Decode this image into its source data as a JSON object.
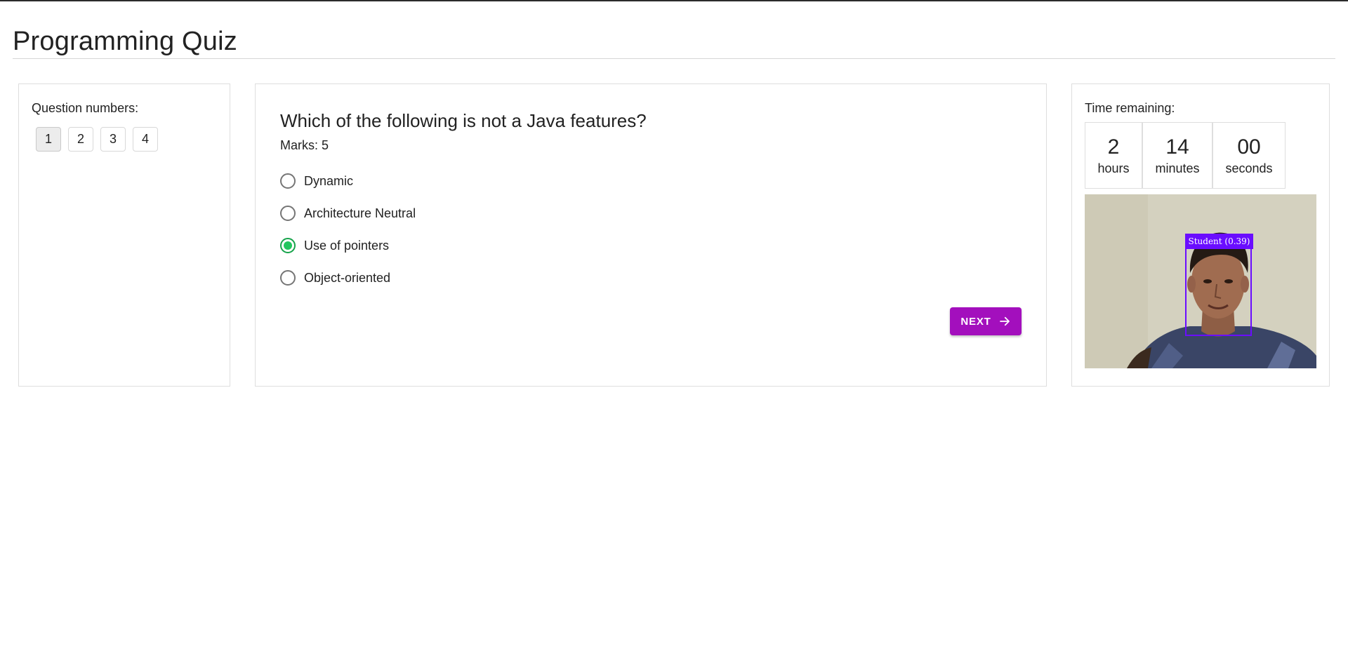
{
  "page": {
    "title": "Programming Quiz"
  },
  "question_nav": {
    "label": "Question numbers:",
    "numbers": [
      "1",
      "2",
      "3",
      "4"
    ],
    "active_index": 0
  },
  "question": {
    "text": "Which of the following is not a Java features?",
    "marks": "Marks: 5",
    "options": [
      {
        "label": "Dynamic",
        "selected": false
      },
      {
        "label": "Architecture Neutral",
        "selected": false
      },
      {
        "label": "Use of pointers",
        "selected": true
      },
      {
        "label": "Object-oriented",
        "selected": false
      }
    ],
    "next_label": "NEXT"
  },
  "timer": {
    "label": "Time remaining:",
    "hours": "2",
    "hours_unit": "hours",
    "minutes": "14",
    "minutes_unit": "minutes",
    "seconds": "00",
    "seconds_unit": "seconds"
  },
  "webcam": {
    "detection_label": "Student (0.39)"
  },
  "colors": {
    "accent": "#a30fbd",
    "radio_selected": "#22c55e",
    "detection": "#6a0dff"
  },
  "icons": {
    "next": "arrow-right-icon"
  }
}
